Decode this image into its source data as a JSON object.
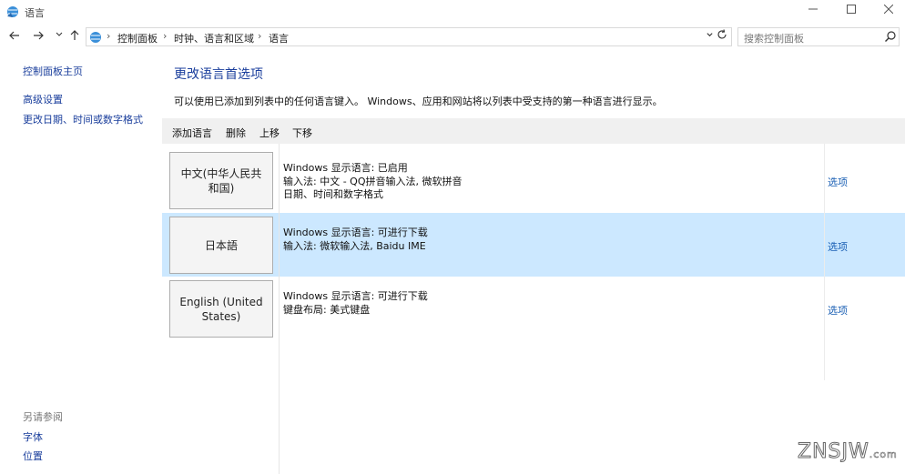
{
  "window": {
    "title": "语言"
  },
  "nav": {
    "breadcrumb": [
      "控制面板",
      "时钟、语言和区域",
      "语言"
    ],
    "search_placeholder": "搜索控制面板"
  },
  "sidebar": {
    "home": "控制面板主页",
    "links": [
      "高级设置",
      "更改日期、时间或数字格式"
    ],
    "see_also_title": "另请参阅",
    "see_also": [
      "字体",
      "位置"
    ]
  },
  "main": {
    "title": "更改语言首选项",
    "description": "可以使用已添加到列表中的任何语言键入。 Windows、应用和网站将以列表中受支持的第一种语言进行显示。",
    "toolbar": [
      "添加语言",
      "删除",
      "上移",
      "下移"
    ],
    "languages": [
      {
        "name": "中文(中华人民共和国)",
        "lines": [
          "Windows 显示语言: 已启用",
          "输入法: 中文 - QQ拼音输入法, 微软拼音",
          "日期、时间和数字格式"
        ],
        "option": "选项"
      },
      {
        "name": "日本語",
        "lines": [
          "Windows 显示语言: 可进行下载",
          "输入法: 微软输入法, Baidu IME"
        ],
        "option": "选项"
      },
      {
        "name": "English (United States)",
        "lines": [
          "Windows 显示语言: 可进行下载",
          "键盘布局: 美式键盘"
        ],
        "option": "选项"
      }
    ]
  },
  "watermark": {
    "main": "ZNSJW",
    "suffix": ".com"
  },
  "colors": {
    "link": "#1a3e9c",
    "selected_row": "#cce8ff",
    "toolbar_bg": "#f0f0f0"
  }
}
